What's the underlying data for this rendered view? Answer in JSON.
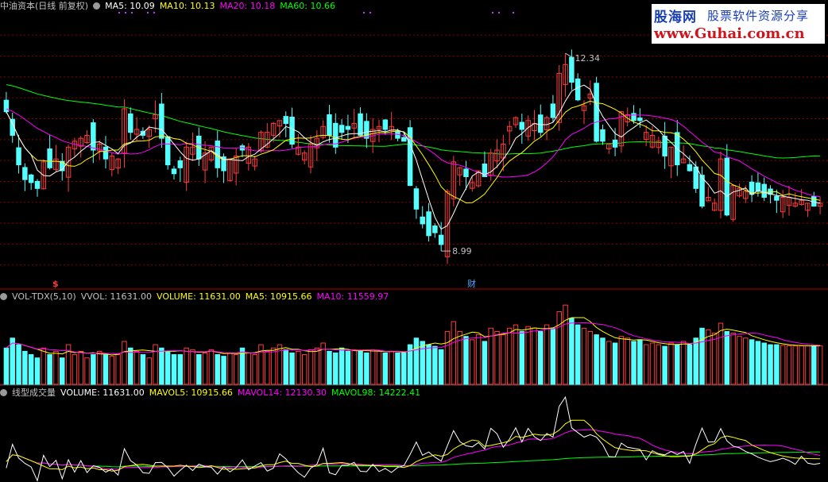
{
  "colors": {
    "bg": "#000000",
    "grid": "#8b0000",
    "up": "#ff3c3c",
    "down": "#54ffff",
    "ma5": "#ffffff",
    "ma10": "#ffff00",
    "ma20": "#ff00ff",
    "ma60": "#00ff00",
    "sep": "#b00000"
  },
  "header": {
    "title": "中油资本(日线 前复权)",
    "ma5": "MA5: 10.09",
    "ma10": "MA10: 10.13",
    "ma20": "MA20: 10.18",
    "ma60": "MA60: 10.66"
  },
  "vol_header": {
    "name": "VOL-TDX(5,10)",
    "vvol": "VVOL: 11631.00",
    "volume": "VOLUME: 11631.00",
    "ma5": "MA5: 10915.66",
    "ma10": "MA10: 11559.97"
  },
  "lv_header": {
    "name": "线型成交量",
    "volume": "VOLUME: 11631.00",
    "mavol5": "MAVOL5: 10915.66",
    "mavol14": "MAVOL14: 12130.30",
    "mavol98": "MAVOL98: 14222.41"
  },
  "markers": {
    "high_label": "12.34",
    "low_label": "8.99",
    "dollar": "$",
    "cai": "财"
  },
  "watermark": {
    "line1": "股海网",
    "line2": "股票软件资源分享",
    "line3": "www.Guhai.com.cn"
  },
  "chart_data": {
    "type": "candlestick",
    "title": "中油资本(日线 前复权)",
    "price_range": [
      8.4,
      13.0
    ],
    "high": 12.34,
    "low": 8.99,
    "close": [
      11.35,
      10.95,
      10.45,
      10.2,
      10.15,
      10.05,
      10.5,
      10.4,
      10.55,
      10.35,
      10.75,
      10.85,
      10.9,
      10.95,
      10.7,
      10.8,
      10.55,
      10.6,
      10.55,
      11.4,
      11.0,
      11.05,
      10.95,
      11.05,
      11.3,
      10.9,
      10.45,
      10.3,
      10.4,
      10.75,
      10.75,
      10.55,
      10.65,
      10.75,
      10.4,
      10.35,
      10.55,
      10.6,
      10.7,
      10.75,
      10.55,
      11.0,
      11.0,
      11.15,
      11.2,
      11.15,
      10.8,
      10.75,
      10.65,
      10.8,
      10.9,
      11.1,
      10.95,
      10.75,
      11.0,
      11.05,
      11.15,
      10.95,
      10.9,
      11.05,
      11.1,
      11.05,
      11.1,
      10.9,
      10.85,
      10.1,
      9.7,
      9.45,
      9.25,
      9.3,
      9.1,
      10.0,
      10.5,
      10.4,
      10.25,
      10.15,
      10.35,
      10.25,
      10.65,
      10.7,
      10.8,
      11.1,
      11.25,
      11.05,
      11.2,
      11.15,
      11.0,
      11.25,
      11.25,
      12.0,
      12.15,
      11.85,
      11.55,
      11.45,
      11.65,
      10.85,
      10.85,
      10.8,
      10.75,
      11.35,
      11.3,
      11.2,
      11.2,
      11.0,
      10.95,
      10.85,
      10.6,
      10.75,
      10.45,
      10.55,
      10.35,
      10.05,
      9.75,
      9.9,
      9.8,
      10.55,
      9.6,
      10.1,
      10.05,
      10.0,
      9.95,
      10.0,
      9.9,
      9.95,
      9.85,
      9.9,
      9.9,
      9.8,
      9.85,
      9.8,
      9.75,
      9.8
    ],
    "volume": [
      11000,
      14000,
      12000,
      10000,
      9000,
      8000,
      11000,
      9000,
      10000,
      8000,
      12000,
      9000,
      10000,
      8000,
      9000,
      10000,
      9000,
      8500,
      9000,
      13000,
      11000,
      10000,
      9000,
      8000,
      12000,
      11000,
      10000,
      9000,
      9000,
      11000,
      10500,
      9000,
      9500,
      10500,
      9000,
      8500,
      9500,
      9000,
      11000,
      9500,
      9000,
      12000,
      10000,
      11000,
      12000,
      10500,
      9500,
      10000,
      9000,
      10500,
      11000,
      12500,
      10000,
      9500,
      11000,
      10000,
      10500,
      10000,
      9500,
      10500,
      10000,
      9500,
      10000,
      9500,
      9500,
      12000,
      14000,
      13000,
      12000,
      11500,
      10500,
      16000,
      19000,
      16000,
      14500,
      13500,
      15000,
      13000,
      17000,
      16000,
      15000,
      17000,
      18000,
      16000,
      17500,
      17000,
      16000,
      18000,
      17000,
      22000,
      24000,
      20000,
      18000,
      17000,
      16000,
      15000,
      14000,
      13000,
      12500,
      14500,
      14000,
      13000,
      13500,
      12000,
      12500,
      12000,
      11500,
      12500,
      12000,
      13000,
      12000,
      14000,
      17000,
      16500,
      15500,
      18500,
      16000,
      15500,
      14500,
      14000,
      13500,
      13000,
      12500,
      12000,
      12000,
      11800,
      11700,
      11600,
      11650,
      11631,
      11700,
      11631
    ]
  }
}
